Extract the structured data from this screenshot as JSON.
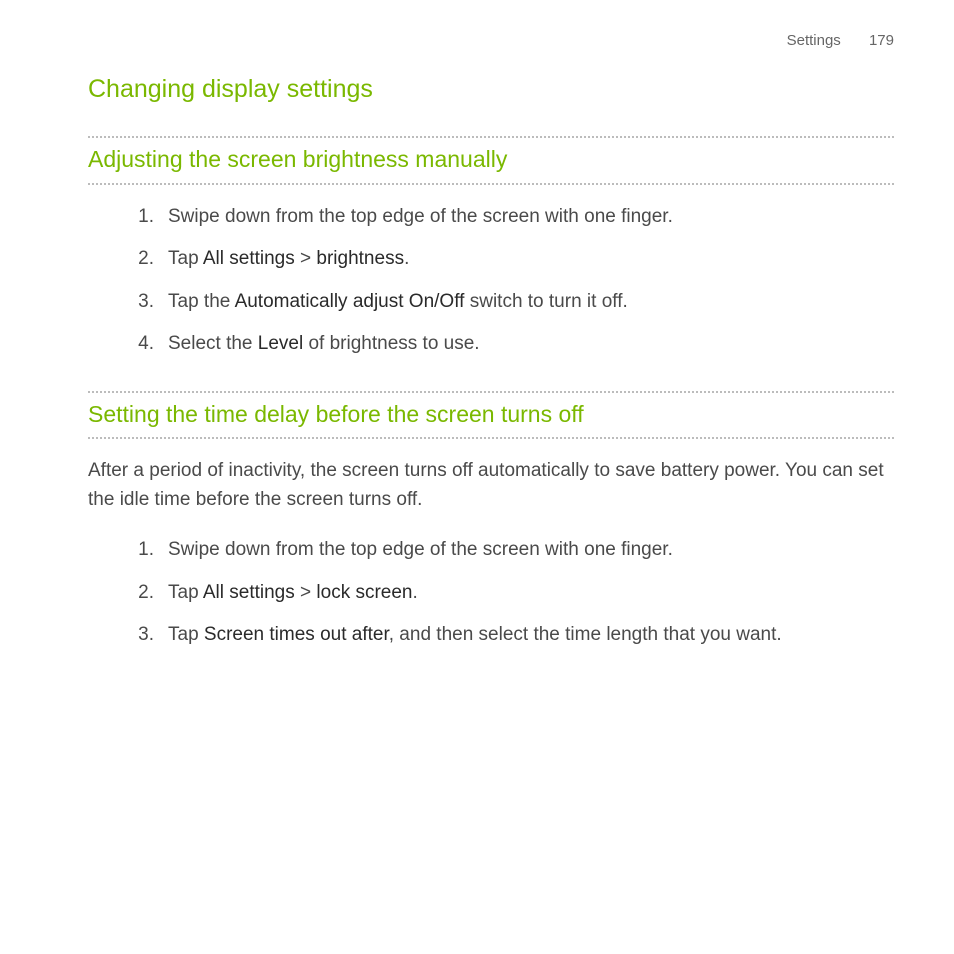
{
  "header": {
    "section": "Settings",
    "page": "179"
  },
  "title": "Changing display settings",
  "section1": {
    "heading": "Adjusting the screen brightness manually",
    "steps": {
      "s1": "Swipe down from the top edge of the screen with one finger.",
      "s2_pre": "Tap ",
      "s2_path_a": "All settings",
      "s2_sep": " > ",
      "s2_path_b": "brightness",
      "s2_post": ".",
      "s3_pre": "Tap the ",
      "s3_em": "Automatically adjust On/Off",
      "s3_post": " switch to turn it off.",
      "s4_pre": "Select the ",
      "s4_em": "Level",
      "s4_post": " of brightness to use."
    }
  },
  "section2": {
    "heading": "Setting the time delay before the screen turns off",
    "intro": "After a period of inactivity, the screen turns off automatically to save battery power. You can set the idle time before the screen turns off.",
    "steps": {
      "s1": "Swipe down from the top edge of the screen with one finger.",
      "s2_pre": "Tap ",
      "s2_path_a": "All settings",
      "s2_sep": " > ",
      "s2_path_b": "lock screen",
      "s2_post": ".",
      "s3_pre": "Tap ",
      "s3_em": "Screen times out after",
      "s3_post": ", and then select the time length that you want."
    }
  }
}
